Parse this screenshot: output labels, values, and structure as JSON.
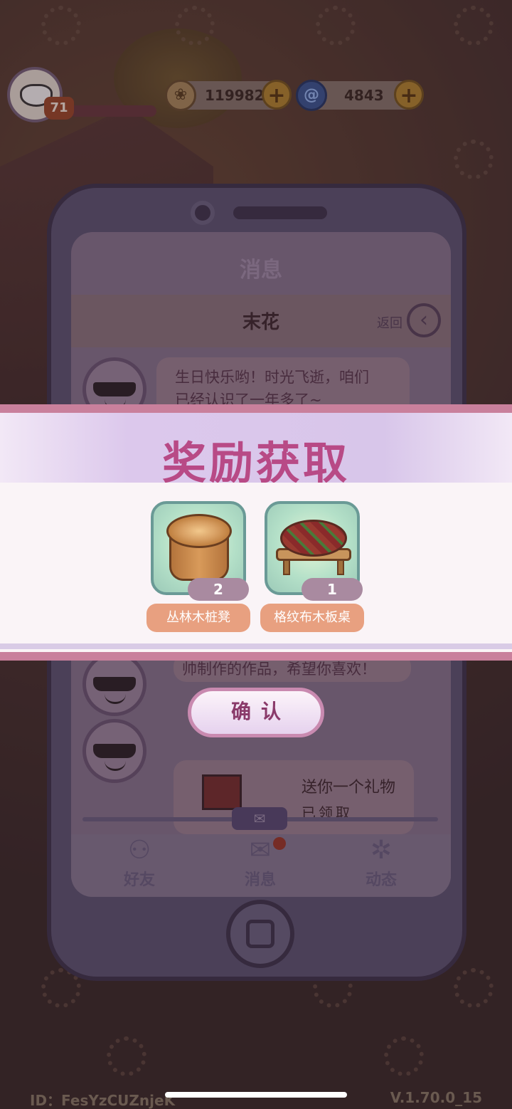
{
  "hud": {
    "level": "71",
    "currency_a": {
      "value": "119982",
      "icon": "leaf-coin-icon"
    },
    "currency_b": {
      "value": "4843",
      "icon": "swirl-gem-icon"
    }
  },
  "phone": {
    "screen_title": "消息",
    "chat_name": "末花",
    "back_label": "返回",
    "messages": [
      {
        "text_line1": "生日快乐哟！时光飞逝，咱们",
        "text_line2": "已经认识了一年多了~"
      },
      {
        "text_partial": "帅制作的作品，希望你喜欢！"
      }
    ],
    "gift": {
      "text": "送你一个礼物",
      "status": "已领取"
    },
    "tabs": [
      {
        "label": "好友",
        "icon": "friends-icon"
      },
      {
        "label": "消息",
        "icon": "mail-icon"
      },
      {
        "label": "动态",
        "icon": "camera-aperture-icon"
      }
    ]
  },
  "reward": {
    "title": "奖励获取",
    "items": [
      {
        "name": "丛林木桩凳",
        "count": "2",
        "icon": "tree-stump-stool-icon"
      },
      {
        "name": "格纹布木板桌",
        "count": "1",
        "icon": "plaid-wooden-table-icon"
      }
    ],
    "confirm_label": "确认"
  },
  "footer": {
    "id_label": "ID：FesYzCUZnjeK",
    "version": "V.1.70.0_15"
  }
}
